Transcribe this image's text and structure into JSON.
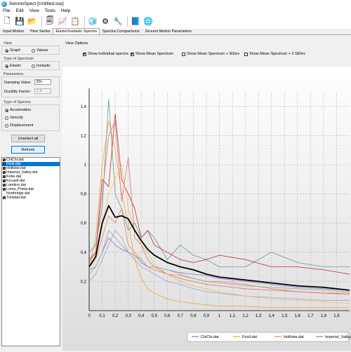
{
  "window": {
    "title": "SeismoSpect  [Untitled.ssp]"
  },
  "menu": [
    "File",
    "Edit",
    "View",
    "Tools",
    "Help"
  ],
  "toolbar": [
    {
      "icon": "new-file-icon",
      "glyph": "🗋"
    },
    {
      "icon": "save-icon",
      "glyph": "💾"
    },
    {
      "icon": "open-folder-icon",
      "glyph": "📂"
    },
    {
      "icon": "documents-icon",
      "glyph": "🗐"
    },
    {
      "icon": "chart-report-icon",
      "glyph": "📈"
    },
    {
      "icon": "table-report-icon",
      "glyph": "📋"
    },
    {
      "icon": "modules-icon",
      "glyph": "🧊"
    },
    {
      "icon": "settings-gear-icon",
      "glyph": "⚙"
    },
    {
      "icon": "tools-icon",
      "glyph": "🔧"
    },
    {
      "icon": "help-book-icon",
      "glyph": "📘"
    },
    {
      "icon": "web-globe-icon",
      "glyph": "🌐"
    }
  ],
  "tabs": [
    "Input Motion",
    "Time Series",
    "Elastic/Inelastic Spectra",
    "Spectra Comparisons",
    "Ground Motion Parameters"
  ],
  "active_tab": 2,
  "view": {
    "title": "View",
    "options": [
      "Graph",
      "Values"
    ],
    "selected": "Graph"
  },
  "spectrum_type": {
    "title": "Type of Spectrum",
    "options": [
      "Elastic",
      "Inelastic"
    ],
    "selected": "Elastic"
  },
  "parameters": {
    "title": "Parameters",
    "damping_label": "Damping Value:",
    "damping_value": "5%",
    "ductility_label": "Ductility Factor:",
    "ductility_value": "1.5"
  },
  "spectra_type": {
    "title": "Type of Spectra",
    "options": [
      "Acceleration",
      "Velocity",
      "Displacement"
    ],
    "selected": "Acceleration"
  },
  "buttons": {
    "unselect_all": "Unselect all",
    "refresh": "Refresh"
  },
  "files": [
    {
      "name": "ChiChi.dat",
      "checked": true,
      "selected": false
    },
    {
      "name": "Friuli.dat",
      "checked": true,
      "selected": true
    },
    {
      "name": "Hollister.dat",
      "checked": true,
      "selected": false
    },
    {
      "name": "Imperial_Valley.dat",
      "checked": true,
      "selected": false
    },
    {
      "name": "Kobe.dat",
      "checked": true,
      "selected": false
    },
    {
      "name": "Kocaeli.dat",
      "checked": true,
      "selected": false
    },
    {
      "name": "Landers.dat",
      "checked": true,
      "selected": false
    },
    {
      "name": "Loma_Prieta.dat",
      "checked": true,
      "selected": false
    },
    {
      "name": "Northridge.dat",
      "checked": false,
      "selected": false
    },
    {
      "name": "Trinidad.dat",
      "checked": true,
      "selected": false
    }
  ],
  "view_options": {
    "title": "View Options",
    "items": [
      {
        "label": "Show individual spectra",
        "checked": true
      },
      {
        "label": "Show Mean Spectrum",
        "checked": true
      },
      {
        "label": "Show Mean Spectrum + StDev",
        "checked": false
      },
      {
        "label": "Show Mean Spectrum + 2 StDev",
        "checked": false
      }
    ]
  },
  "chart_data": {
    "type": "line",
    "xlabel": "",
    "ylabel": "",
    "xlim": [
      0,
      2.0
    ],
    "ylim": [
      0,
      1.5
    ],
    "x_ticks": [
      "0",
      "0,1",
      "0,2",
      "0,3",
      "0,4",
      "0,5",
      "0,6",
      "0,7",
      "0,8",
      "0,9",
      "1",
      "1,1",
      "1,2",
      "1,3",
      "1,4",
      "1,5",
      "1,6",
      "1,7",
      "1,8",
      "1,9"
    ],
    "y_ticks": [
      "0,2",
      "0,4",
      "0,6",
      "0,8",
      "1",
      "1,2",
      "1,4"
    ],
    "grid": true,
    "legend_position": "bottom",
    "legend": [
      "ChiChi.dat",
      "Friuli.dat",
      "Hollister.dat",
      "Imperial_Valley.d"
    ],
    "x": [
      0,
      0.05,
      0.1,
      0.15,
      0.2,
      0.25,
      0.3,
      0.35,
      0.4,
      0.45,
      0.5,
      0.6,
      0.7,
      0.8,
      0.9,
      1.0,
      1.2,
      1.4,
      1.6,
      1.8,
      2.0
    ],
    "series": [
      {
        "name": "ChiChi.dat",
        "color": "#8a6fd0",
        "values": [
          0.28,
          0.3,
          0.4,
          0.5,
          0.45,
          0.42,
          0.4,
          0.38,
          0.33,
          0.3,
          0.3,
          0.28,
          0.26,
          0.25,
          0.24,
          0.22,
          0.2,
          0.18,
          0.16,
          0.15,
          0.14
        ]
      },
      {
        "name": "Friuli.dat",
        "color": "#e8a830",
        "values": [
          0.3,
          0.5,
          1.0,
          1.3,
          1.1,
          0.8,
          0.6,
          0.35,
          0.22,
          0.15,
          0.12,
          0.08,
          0.06,
          0.05,
          0.04,
          0.03,
          0.03,
          0.02,
          0.02,
          0.02,
          0.02
        ]
      },
      {
        "name": "Hollister.dat",
        "color": "#f08050",
        "values": [
          0.3,
          0.35,
          0.5,
          0.65,
          0.6,
          0.7,
          0.45,
          0.4,
          0.35,
          0.3,
          0.28,
          0.25,
          0.24,
          0.22,
          0.2,
          0.2,
          0.18,
          0.15,
          0.13,
          0.12,
          0.11
        ]
      },
      {
        "name": "Imperial_Valley.d",
        "color": "#6a9a9a",
        "values": [
          0.4,
          0.45,
          0.7,
          1.45,
          0.8,
          0.7,
          0.55,
          0.6,
          0.5,
          0.55,
          0.5,
          0.35,
          0.45,
          0.38,
          0.35,
          0.3,
          0.3,
          0.4,
          0.33,
          0.3,
          0.3
        ]
      },
      {
        "name": "Kobe.dat",
        "color": "#c03030",
        "values": [
          0.35,
          0.4,
          0.9,
          0.85,
          1.35,
          0.9,
          0.8,
          0.7,
          0.5,
          0.55,
          0.45,
          0.4,
          0.35,
          0.33,
          0.35,
          0.38,
          0.35,
          0.3,
          0.3,
          0.28,
          0.25
        ]
      },
      {
        "name": "Kocaeli.dat",
        "color": "#e07070",
        "values": [
          0.33,
          0.4,
          0.8,
          1.2,
          1.3,
          0.75,
          1.05,
          0.5,
          0.45,
          0.35,
          0.3,
          0.25,
          0.22,
          0.2,
          0.18,
          0.17,
          0.15,
          0.14,
          0.13,
          0.12,
          0.12
        ]
      },
      {
        "name": "Landers.dat",
        "color": "#a0a0d0",
        "values": [
          0.2,
          0.25,
          0.35,
          0.45,
          0.55,
          0.5,
          0.4,
          0.35,
          0.3,
          0.28,
          0.25,
          0.2,
          0.18,
          0.15,
          0.13,
          0.12,
          0.1,
          0.09,
          0.08,
          0.07,
          0.07
        ]
      },
      {
        "name": "Loma_Prieta.dat",
        "color": "#f0c060",
        "values": [
          0.3,
          0.35,
          0.6,
          0.8,
          0.9,
          1.0,
          0.7,
          0.55,
          0.45,
          0.4,
          0.32,
          0.25,
          0.2,
          0.17,
          0.15,
          0.13,
          0.1,
          0.08,
          0.07,
          0.06,
          0.05
        ]
      },
      {
        "name": "Trinidad.dat",
        "color": "#90b090",
        "values": [
          0.25,
          0.3,
          0.4,
          0.55,
          0.5,
          0.45,
          0.4,
          0.38,
          0.35,
          0.3,
          0.3,
          0.28,
          0.25,
          0.22,
          0.2,
          0.19,
          0.17,
          0.16,
          0.15,
          0.14,
          0.13
        ]
      },
      {
        "name": "Mean Spectrum",
        "color": "#000000",
        "values": [
          0.3,
          0.37,
          0.6,
          0.72,
          0.64,
          0.65,
          0.63,
          0.55,
          0.48,
          0.42,
          0.38,
          0.33,
          0.3,
          0.28,
          0.25,
          0.23,
          0.21,
          0.19,
          0.17,
          0.16,
          0.14
        ]
      }
    ]
  }
}
